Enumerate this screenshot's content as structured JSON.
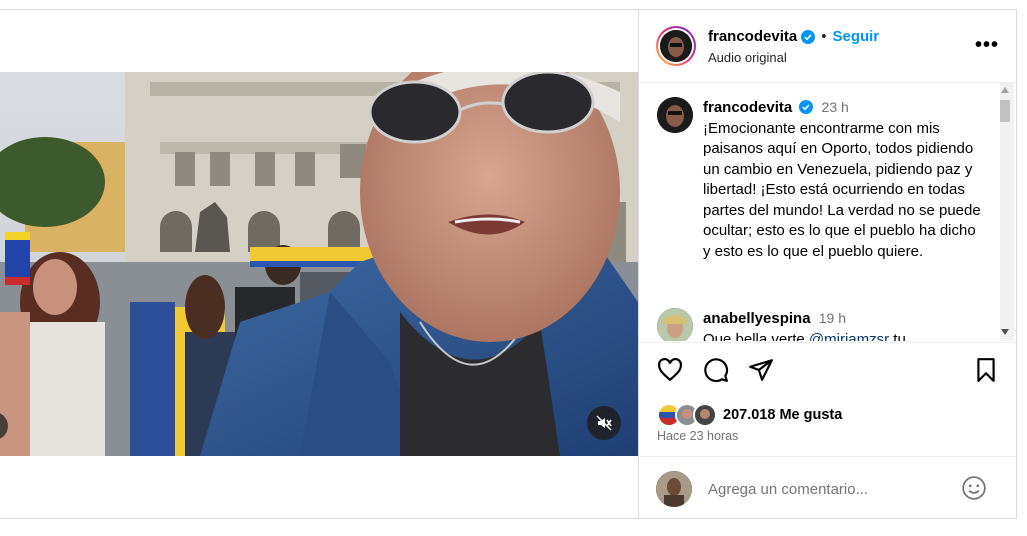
{
  "post": {
    "username": "francodevita",
    "follow_label": "Seguir",
    "separator": "•",
    "audio": "Audio original",
    "more": "•••"
  },
  "caption": {
    "username": "francodevita",
    "time": "23 h",
    "text": "¡Emocionante encontrarme con mis paisanos aquí en Oporto, todos pidiendo un cambio en Venezuela, pidiendo paz y libertad! ¡Esto está ocurriendo en todas partes del mundo! La verdad no se puede ocultar; esto es lo que el pueblo ha dicho y esto es lo que el pueblo quiere."
  },
  "comments": [
    {
      "username": "anabellyespina",
      "time": "19 h",
      "text_before": "Que bella verte ",
      "mention": "@miriamzsr",
      "text_after": " tu"
    }
  ],
  "stats": {
    "likes": "207.018 Me gusta",
    "ago": "Hace 23 horas"
  },
  "comment_box": {
    "placeholder": "Agrega un comentario..."
  },
  "colors": {
    "accent": "#0095f6",
    "verified": "#0095f6",
    "muted_text": "#737373"
  },
  "icons": [
    "verified-badge-icon",
    "more-options-icon",
    "heart-icon",
    "comment-icon",
    "share-icon",
    "bookmark-icon",
    "emoji-icon",
    "mute-icon"
  ]
}
